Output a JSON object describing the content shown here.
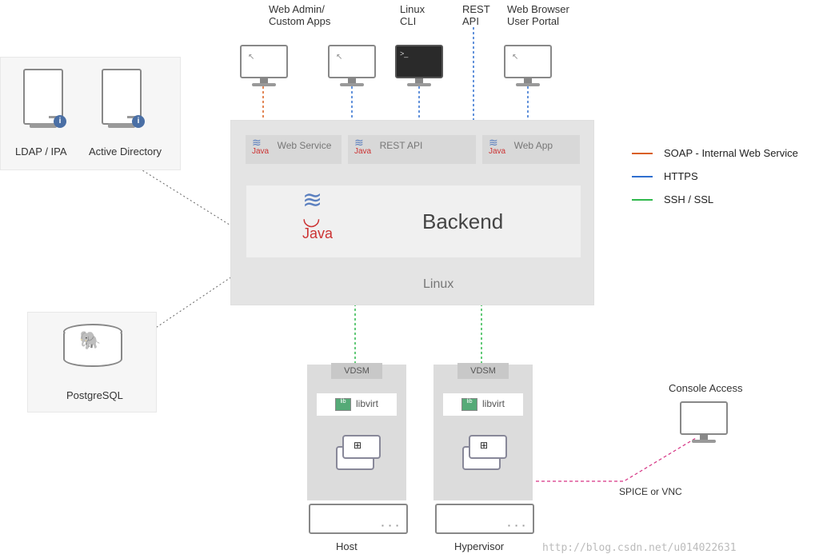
{
  "top": {
    "webadmin_l1": "Web Admin/",
    "webadmin_l2": "Custom Apps",
    "linux_l1": "Linux",
    "linux_l2": "CLI",
    "rest_l1": "REST",
    "rest_l2": "API",
    "browser_l1": "Web Browser",
    "browser_l2": "User Portal"
  },
  "left": {
    "ldap": "LDAP / IPA",
    "ad": "Active Directory",
    "pg": "PostgreSQL"
  },
  "middle": {
    "ws": "Web Service",
    "rest": "REST API",
    "wa": "Web App",
    "backend": "Backend",
    "os": "Linux",
    "java": "Java"
  },
  "hosts": {
    "vdsm": "VDSM",
    "libvirt": "libvirt",
    "host1": "Host",
    "host2": "Hypervisor"
  },
  "right": {
    "console": "Console Access",
    "spice": "SPICE or VNC"
  },
  "legend": {
    "soap": "SOAP - Internal Web Service",
    "https": "HTTPS",
    "ssh": "SSH / SSL"
  },
  "wm": "http://blog.csdn.net/u014022631",
  "colors": {
    "soap": "#d95f1e",
    "https": "#2f6fcf",
    "ssh": "#2fb84c",
    "spice": "#d63384"
  }
}
